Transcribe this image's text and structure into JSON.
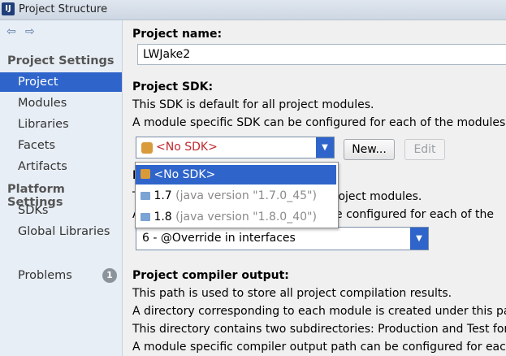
{
  "window": {
    "title": "Project Structure",
    "app_icon": "intellij-icon"
  },
  "nav": {
    "back": "⇦",
    "forward": "⇨"
  },
  "sidebar": {
    "project_settings_header": "Project Settings",
    "items": [
      {
        "label": "Project",
        "selected": true
      },
      {
        "label": "Modules"
      },
      {
        "label": "Libraries"
      },
      {
        "label": "Facets"
      },
      {
        "label": "Artifacts"
      }
    ],
    "platform_settings_header": "Platform Settings",
    "platform_items": [
      {
        "label": "SDKs"
      },
      {
        "label": "Global Libraries"
      }
    ],
    "problems": {
      "label": "Problems",
      "count": "1"
    }
  },
  "main": {
    "project_name_label": "Project name:",
    "project_name_value": "LWJake2",
    "sdk_label": "Project SDK:",
    "sdk_desc1": "This SDK is default for all project modules.",
    "sdk_desc2": "A module specific SDK can be configured for each of the modules a",
    "sdk_selected": "<No SDK>",
    "new_button": "New...",
    "edit_button": "Edit",
    "lang_desc1_tail": "roject modules.",
    "lang_desc2_tail": "e configured for each of the",
    "lang_level_value": "6 - @Override in interfaces",
    "compiler_output_label": "Project compiler output:",
    "compiler_desc1": "This path is used to store all project compilation results.",
    "compiler_desc2": "A directory corresponding to each module is created under this pat",
    "compiler_desc3": "This directory contains two subdirectories: Production and Test for",
    "compiler_desc4": "A module specific compiler output path can be configured for each"
  },
  "sdk_dropdown": {
    "options": [
      {
        "name": "<No SDK>",
        "detail": ""
      },
      {
        "name": "1.7",
        "detail": "(java version \"1.7.0_45\")"
      },
      {
        "name": "1.8",
        "detail": "(java version \"1.8.0_40\")"
      }
    ]
  },
  "colors": {
    "selection": "#2f65ca",
    "no_sdk_red": "#c0282e"
  }
}
